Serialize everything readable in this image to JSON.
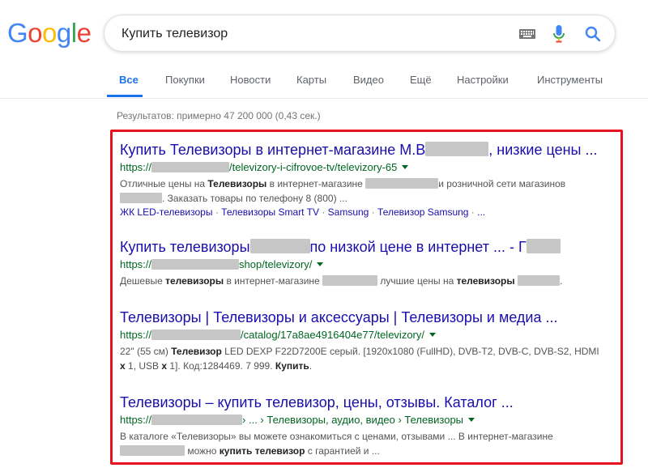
{
  "logo": {
    "letters": [
      "G",
      "o",
      "o",
      "g",
      "l",
      "e"
    ],
    "colors": [
      "#4285f4",
      "#ea4335",
      "#fbbc05",
      "#4285f4",
      "#34a853",
      "#ea4335"
    ]
  },
  "search": {
    "query": "Купить телевизор",
    "icons": [
      "keyboard-icon",
      "microphone-icon",
      "search-icon"
    ]
  },
  "tabs": [
    "Все",
    "Покупки",
    "Новости",
    "Карты",
    "Видео",
    "Ещё",
    "Настройки",
    "Инструменты"
  ],
  "stats": "Результатов: примерно 47 200 000 (0,43 сек.)",
  "colors": {
    "accent": "#1a73e8",
    "title": "#1a0dab",
    "url": "#006621",
    "highlight_frame": "#e8121e"
  },
  "results": [
    {
      "title_a": "Купить Телевизоры в интернет-магазине М.В",
      "title_b": ", низкие цены ...",
      "url_a": "https://",
      "url_b": "/televizory-i-cifrovoe-tv/televizory-65",
      "snippet": [
        {
          "t": "Отличные цены на ",
          "b": false
        },
        {
          "t": "Телевизоры",
          "b": true
        },
        {
          "t": " в интернет-магазине ",
          "b": false
        },
        {
          "t": "",
          "blur": 90
        },
        {
          "t": "и розничной сети магазинов ",
          "b": false
        },
        {
          "t": "",
          "blur": 52
        },
        {
          "t": ". Заказать товары по телефону 8 (800) ...",
          "b": false
        }
      ],
      "links": [
        "ЖК LED-телевизоры",
        "Телевизоры Smart TV",
        "Samsung",
        "Телевизор Samsung",
        "..."
      ]
    },
    {
      "title_a": "Купить телевизоры",
      "title_b": "по низкой цене в интернет ... - Г",
      "url_a": "https://",
      "url_b": "shop/televizory/",
      "snippet": [
        {
          "t": "Дешевые ",
          "b": false
        },
        {
          "t": "телевизоры",
          "b": true
        },
        {
          "t": " в интернет-магазине ",
          "b": false
        },
        {
          "t": "",
          "blur": 68
        },
        {
          "t": " лучшие цены на ",
          "b": false
        },
        {
          "t": "телевизоры",
          "b": true
        },
        {
          "t": " ",
          "b": false
        },
        {
          "t": "",
          "blur": 52
        },
        {
          "t": ".",
          "b": false
        }
      ]
    },
    {
      "title_a": "Телевизоры | Телевизоры и аксессуары | Телевизоры и медиа ...",
      "title_b": "",
      "url_a": "https://",
      "url_b": "/catalog/17a8ae4916404e77/televizory/",
      "snippet": [
        {
          "t": "22\" (55 см) ",
          "b": false
        },
        {
          "t": "Телевизор",
          "b": true
        },
        {
          "t": " LED DEXP F22D7200E серый. [1920x1080 (FullHD), DVB-T2, DVB-C, DVB-S2, HDMI ",
          "b": false
        },
        {
          "t": "x",
          "b": true
        },
        {
          "t": " 1, USB ",
          "b": false
        },
        {
          "t": "x",
          "b": true
        },
        {
          "t": " 1]. Код:1284469. 7 999. ",
          "b": false
        },
        {
          "t": "Купить",
          "b": true
        },
        {
          "t": ".",
          "b": false
        }
      ]
    },
    {
      "title_a": "Телевизоры – купить телевизор, цены, отзывы. Каталог ...",
      "title_b": "",
      "url_a": "https://",
      "url_b": "› ... › Телевизоры, аудио, видео › Телевизоры",
      "snippet": [
        {
          "t": "В каталоге «Телевизоры» вы можете ознакомиться с ценами, отзывами ... В интернет-магазине ",
          "b": false
        },
        {
          "t": "",
          "blur": 80
        },
        {
          "t": " можно ",
          "b": false
        },
        {
          "t": "купить телевизор",
          "b": true
        },
        {
          "t": " с гарантией и ...",
          "b": false
        }
      ]
    }
  ]
}
